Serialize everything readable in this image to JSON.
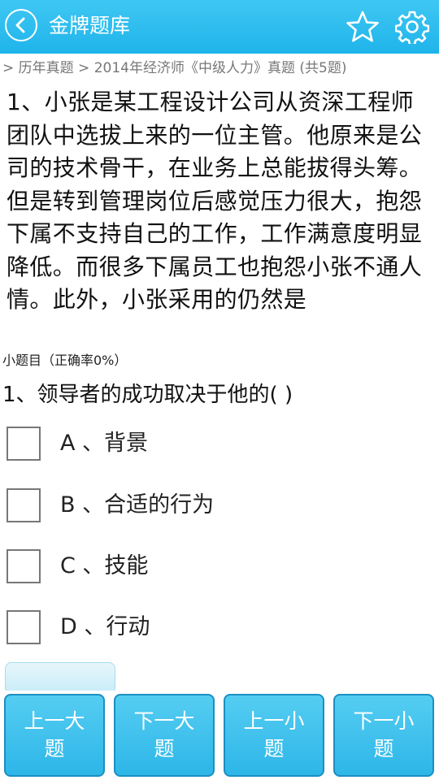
{
  "header": {
    "title": "金牌题库",
    "back_icon": "chevron-left-icon",
    "favorite_icon": "star-icon",
    "settings_icon": "gear-icon"
  },
  "breadcrumb": "> 历年真题 > 2014年经济师《中级人力》真题 (共5题)",
  "question": {
    "text": "1、小张是某工程设计公司从资深工程师团队中选拔上来的一位主管。他原来是公司的技术骨干，在业务上总能拔得头筹。但是转到管理岗位后感觉压力很大，抱怨下属不支持自己的工作，工作满意度明显降低。而很多下属员工也抱怨小张不通人情。此外，小张采用的仍然是"
  },
  "sub_question": {
    "header": "小题目（正确率0%）",
    "text": "1、领导者的成功取决于他的( )",
    "options": [
      {
        "label": "A 、背景"
      },
      {
        "label": "B 、合适的行为"
      },
      {
        "label": "C 、技能"
      },
      {
        "label": "D 、行动"
      }
    ]
  },
  "nav": {
    "prev_major": "上一大题",
    "next_major": "下一大题",
    "prev_minor": "上一小题",
    "next_minor": "下一小题"
  },
  "colors": {
    "accent": "#1fb4ea",
    "button_border": "#1b8fc2"
  }
}
